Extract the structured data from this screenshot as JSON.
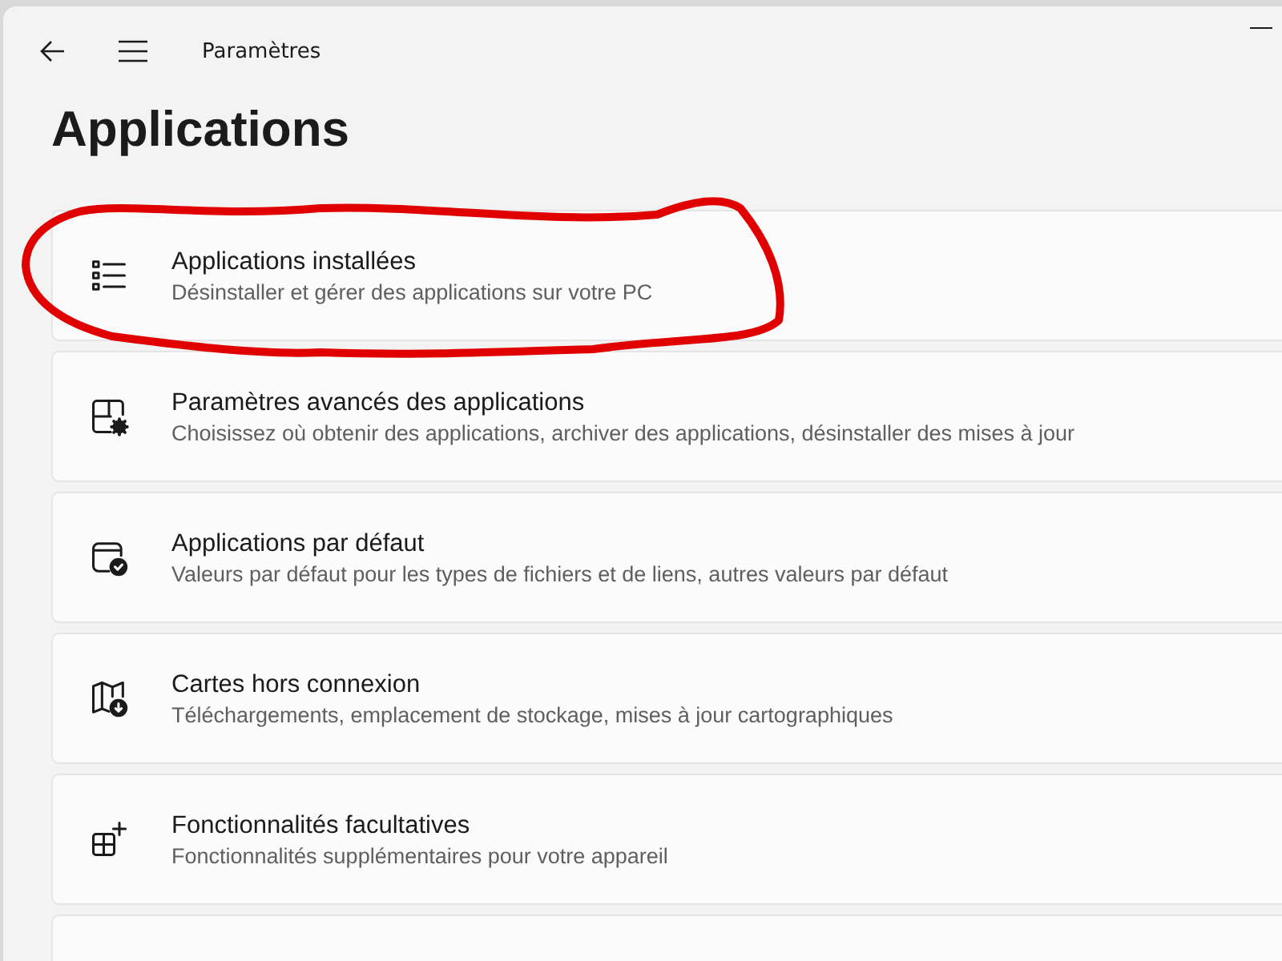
{
  "window": {
    "title": "Paramètres"
  },
  "page": {
    "heading": "Applications"
  },
  "items": [
    {
      "title": "Applications installées",
      "subtitle": "Désinstaller et gérer des applications sur votre PC",
      "highlighted": true
    },
    {
      "title": "Paramètres avancés des applications",
      "subtitle": "Choisissez où obtenir des applications, archiver des applications, désinstaller des mises à jour",
      "highlighted": false
    },
    {
      "title": "Applications par défaut",
      "subtitle": "Valeurs par défaut pour les types de fichiers et de liens, autres valeurs par défaut",
      "highlighted": false
    },
    {
      "title": "Cartes hors connexion",
      "subtitle": "Téléchargements, emplacement de stockage, mises à jour cartographiques",
      "highlighted": false
    },
    {
      "title": "Fonctionnalités facultatives",
      "subtitle": "Fonctionnalités supplémentaires pour votre appareil",
      "highlighted": false
    }
  ]
}
